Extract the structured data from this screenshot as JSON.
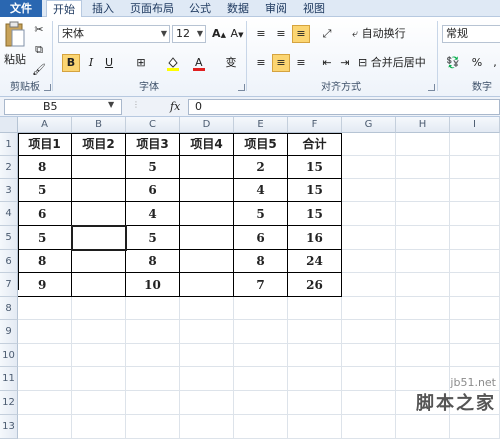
{
  "tabs": [
    "文件",
    "开始",
    "插入",
    "页面布局",
    "公式",
    "数据",
    "审阅",
    "视图"
  ],
  "ribbon": {
    "paste_label": "粘贴",
    "clipboard_label": "剪贴板",
    "font_name": "宋体",
    "font_size": "12",
    "bold": "B",
    "italic": "I",
    "underline": "U",
    "font_group_label": "字体",
    "wrap_text": "自动换行",
    "merge_center": "合并后居中",
    "align_group_label": "对齐方式",
    "number_format": "常规",
    "number_group_label": "数字",
    "percent": "%",
    "comma": ","
  },
  "formula_bar": {
    "name_box": "B5",
    "fx": "fx",
    "formula": "0"
  },
  "columns": [
    "A",
    "B",
    "C",
    "D",
    "E",
    "F",
    "G",
    "H",
    "I"
  ],
  "rows": [
    "1",
    "2",
    "3",
    "4",
    "5",
    "6",
    "7",
    "8",
    "9",
    "10",
    "11",
    "12",
    "13"
  ],
  "table": {
    "headers": [
      "项目1",
      "项目2",
      "项目3",
      "项目4",
      "项目5",
      "合计"
    ],
    "rows": [
      [
        "8",
        "",
        "5",
        "",
        "2",
        "15"
      ],
      [
        "5",
        "",
        "6",
        "",
        "4",
        "15"
      ],
      [
        "6",
        "",
        "4",
        "",
        "5",
        "15"
      ],
      [
        "5",
        "",
        "5",
        "",
        "6",
        "16"
      ],
      [
        "8",
        "",
        "8",
        "",
        "8",
        "24"
      ],
      [
        "9",
        "",
        "10",
        "",
        "7",
        "26"
      ]
    ]
  },
  "watermark": {
    "url": "jb51.net",
    "name": "脚本之家"
  },
  "colors": {
    "file_tab": "#2a67b1",
    "active_highlight": "#fbd572"
  }
}
